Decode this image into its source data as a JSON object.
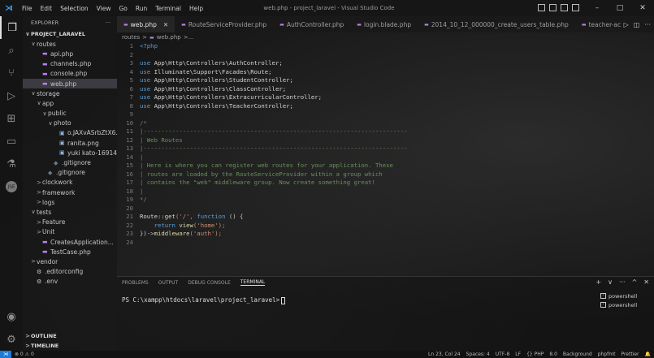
{
  "menu": [
    "File",
    "Edit",
    "Selection",
    "View",
    "Go",
    "Run",
    "Terminal",
    "Help"
  ],
  "window_title": "web.php - project_laravel - Visual Studio Code",
  "window_controls": [
    "–",
    "□",
    "✕"
  ],
  "sidebar": {
    "title": "EXPLORER",
    "more": "···",
    "project": "PROJECT_LARAVEL",
    "items": [
      {
        "chev": "∨",
        "icon": "",
        "label": "routes",
        "indent": 1,
        "type": "folder"
      },
      {
        "chev": "",
        "icon": "php",
        "label": "api.php",
        "indent": 2,
        "type": "php"
      },
      {
        "chev": "",
        "icon": "php",
        "label": "channels.php",
        "indent": 2,
        "type": "php"
      },
      {
        "chev": "",
        "icon": "php",
        "label": "console.php",
        "indent": 2,
        "type": "php"
      },
      {
        "chev": "",
        "icon": "php",
        "label": "web.php",
        "indent": 2,
        "type": "php",
        "selected": true
      },
      {
        "chev": "∨",
        "icon": "",
        "label": "storage",
        "indent": 1,
        "type": "folder"
      },
      {
        "chev": "∨",
        "icon": "",
        "label": "app",
        "indent": 2,
        "type": "folder"
      },
      {
        "chev": "∨",
        "icon": "",
        "label": "public",
        "indent": 3,
        "type": "folder"
      },
      {
        "chev": "∨",
        "icon": "",
        "label": "photo",
        "indent": 4,
        "type": "folder"
      },
      {
        "chev": "",
        "icon": "img",
        "label": "o.JAXvASrbZtX6...",
        "indent": 5,
        "type": "img"
      },
      {
        "chev": "",
        "icon": "img",
        "label": "ranita.png",
        "indent": 5,
        "type": "img"
      },
      {
        "chev": "",
        "icon": "img",
        "label": "yuki kato-16914...",
        "indent": 5,
        "type": "img"
      },
      {
        "chev": "",
        "icon": "git",
        "label": ".gitignore",
        "indent": 4,
        "type": "git"
      },
      {
        "chev": "",
        "icon": "git",
        "label": ".gitignore",
        "indent": 3,
        "type": "git"
      },
      {
        "chev": ">",
        "icon": "",
        "label": "clockwork",
        "indent": 2,
        "type": "folder"
      },
      {
        "chev": ">",
        "icon": "",
        "label": "framework",
        "indent": 2,
        "type": "folder"
      },
      {
        "chev": ">",
        "icon": "",
        "label": "logs",
        "indent": 2,
        "type": "folder"
      },
      {
        "chev": "∨",
        "icon": "",
        "label": "tests",
        "indent": 1,
        "type": "folder"
      },
      {
        "chev": ">",
        "icon": "",
        "label": "Feature",
        "indent": 2,
        "type": "folder"
      },
      {
        "chev": ">",
        "icon": "",
        "label": "Unit",
        "indent": 2,
        "type": "folder"
      },
      {
        "chev": "",
        "icon": "php",
        "label": "CreatesApplication...",
        "indent": 2,
        "type": "php"
      },
      {
        "chev": "",
        "icon": "php",
        "label": "TestCase.php",
        "indent": 2,
        "type": "php"
      },
      {
        "chev": ">",
        "icon": "",
        "label": "vendor",
        "indent": 1,
        "type": "folder"
      },
      {
        "chev": "",
        "icon": "dot",
        "label": ".editorconfig",
        "indent": 1,
        "type": "dot"
      },
      {
        "chev": "",
        "icon": "dot",
        "label": ".env",
        "indent": 1,
        "type": "dot"
      }
    ],
    "outline": "OUTLINE",
    "timeline": "TIMELINE"
  },
  "tabs": [
    {
      "label": "web.php",
      "active": true,
      "close": "✕"
    },
    {
      "label": "RouteServiceProvider.php",
      "active": false
    },
    {
      "label": "AuthController.php",
      "active": false
    },
    {
      "label": "login.blade.php",
      "active": false
    },
    {
      "label": "2014_10_12_000000_create_users_table.php",
      "active": false
    },
    {
      "label": "teacher-ac",
      "active": false
    }
  ],
  "breadcrumb": [
    "routes",
    ">",
    "web.php",
    ">..."
  ],
  "code_lines": [
    {
      "n": "1",
      "tokens": [
        {
          "t": "<?php",
          "c": "kw"
        }
      ]
    },
    {
      "n": "2",
      "tokens": []
    },
    {
      "n": "3",
      "tokens": [
        {
          "t": "use ",
          "c": "kw"
        },
        {
          "t": "App\\Http\\Controllers\\AuthController;",
          "c": "ns"
        }
      ]
    },
    {
      "n": "4",
      "tokens": [
        {
          "t": "use ",
          "c": "kw"
        },
        {
          "t": "Illuminate\\Support\\Facades\\Route;",
          "c": "ns"
        }
      ]
    },
    {
      "n": "5",
      "tokens": [
        {
          "t": "use ",
          "c": "kw"
        },
        {
          "t": "App\\Http\\Controllers\\StudentController;",
          "c": "ns"
        }
      ]
    },
    {
      "n": "6",
      "tokens": [
        {
          "t": "use ",
          "c": "kw"
        },
        {
          "t": "App\\Http\\Controllers\\ClassController;",
          "c": "ns"
        }
      ]
    },
    {
      "n": "7",
      "tokens": [
        {
          "t": "use ",
          "c": "kw"
        },
        {
          "t": "App\\Http\\Controllers\\ExtracurricularController;",
          "c": "ns"
        }
      ]
    },
    {
      "n": "8",
      "tokens": [
        {
          "t": "use ",
          "c": "kw"
        },
        {
          "t": "App\\Http\\Controllers\\TeacherController;",
          "c": "ns"
        }
      ]
    },
    {
      "n": "9",
      "tokens": []
    },
    {
      "n": "10",
      "tokens": [
        {
          "t": "/*",
          "c": "cm"
        }
      ]
    },
    {
      "n": "11",
      "tokens": [
        {
          "t": "|--------------------------------------------------------------------------",
          "c": "cm"
        }
      ]
    },
    {
      "n": "12",
      "tokens": [
        {
          "t": "| Web Routes",
          "c": "cm"
        }
      ]
    },
    {
      "n": "13",
      "tokens": [
        {
          "t": "|--------------------------------------------------------------------------",
          "c": "cm"
        }
      ]
    },
    {
      "n": "14",
      "tokens": [
        {
          "t": "|",
          "c": "cm"
        }
      ]
    },
    {
      "n": "15",
      "tokens": [
        {
          "t": "| Here is where you can register web routes for your application. These",
          "c": "cm"
        }
      ]
    },
    {
      "n": "16",
      "tokens": [
        {
          "t": "| routes are loaded by the RouteServiceProvider within a group which",
          "c": "cm"
        }
      ]
    },
    {
      "n": "17",
      "tokens": [
        {
          "t": "| contains the \"web\" middleware group. Now create something great!",
          "c": "cm"
        }
      ]
    },
    {
      "n": "18",
      "tokens": [
        {
          "t": "|",
          "c": "cm"
        }
      ]
    },
    {
      "n": "19",
      "tokens": [
        {
          "t": "*/",
          "c": "cm"
        }
      ]
    },
    {
      "n": "20",
      "tokens": []
    },
    {
      "n": "21",
      "tokens": [
        {
          "t": "Route::",
          "c": "ns"
        },
        {
          "t": "get",
          "c": "fn"
        },
        {
          "t": "('/', ",
          "c": "str"
        },
        {
          "t": "function ",
          "c": "kw"
        },
        {
          "t": "() {",
          "c": "punc"
        }
      ]
    },
    {
      "n": "22",
      "tokens": [
        {
          "t": "    return ",
          "c": "kw"
        },
        {
          "t": "view",
          "c": "fn"
        },
        {
          "t": "('home');",
          "c": "str"
        }
      ]
    },
    {
      "n": "23",
      "tokens": [
        {
          "t": "})->",
          "c": "punc"
        },
        {
          "t": "middleware",
          "c": "fn"
        },
        {
          "t": "('auth');",
          "c": "str"
        }
      ]
    },
    {
      "n": "24",
      "tokens": []
    }
  ],
  "panel": {
    "tabs": [
      "PROBLEMS",
      "OUTPUT",
      "DEBUG CONSOLE",
      "TERMINAL"
    ],
    "active_tab": "TERMINAL",
    "actions": [
      "+",
      "∨",
      "···",
      "^",
      "✕"
    ],
    "prompt": "PS C:\\xampp\\htdocs\\laravel\\project_laravel>",
    "shells": [
      "powershell",
      "powershell"
    ]
  },
  "status": {
    "left": [
      "⊗ 0 ⚠ 0"
    ],
    "right": [
      "Ln 23, Col 24",
      "Spaces: 4",
      "UTF-8",
      "LF",
      "{} PHP",
      "8.0",
      "Background",
      "phpfmt",
      "Prettier"
    ]
  }
}
